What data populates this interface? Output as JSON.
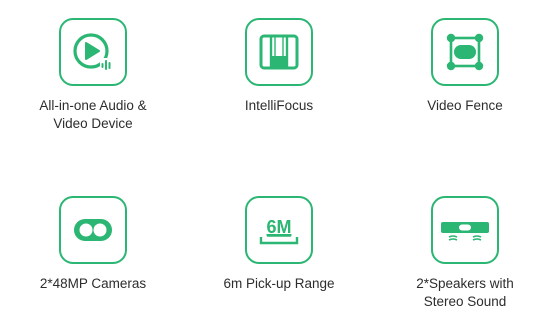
{
  "colors": {
    "accent": "#2bb673",
    "text": "#2d2d2d",
    "background": "#ffffff"
  },
  "features": [
    {
      "icon": "play-audio-icon",
      "label_line1": "All-in-one Audio &",
      "label_line2": "Video Device"
    },
    {
      "icon": "intellifocus-icon",
      "label_line1": "IntelliFocus"
    },
    {
      "icon": "video-fence-icon",
      "label_line1": "Video Fence"
    },
    {
      "icon": "dual-camera-icon",
      "label_line1": "2*48MP Cameras"
    },
    {
      "icon": "pickup-range-icon",
      "icon_text": "6M",
      "label_line1": "6m Pick-up Range"
    },
    {
      "icon": "speakers-icon",
      "label_line1": "2*Speakers with",
      "label_line2": "Stereo Sound"
    }
  ]
}
